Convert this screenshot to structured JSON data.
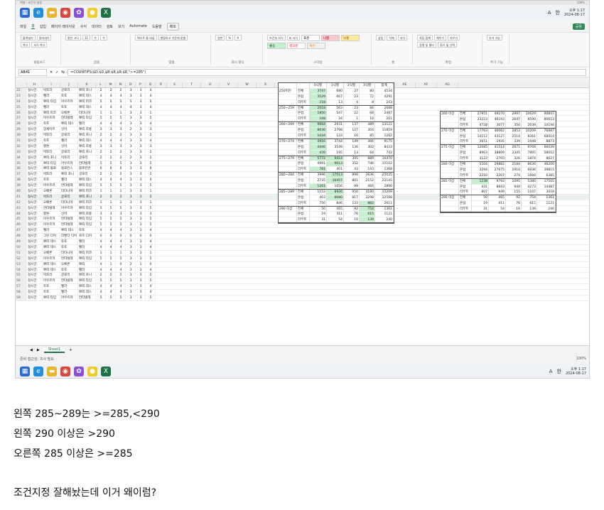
{
  "window": {
    "top_left": "엑셀 - 조건식 설정",
    "top_right": "100%"
  },
  "taskbar": {
    "icons": [
      {
        "name": "windows-icon",
        "glyph": "▦",
        "color": "#2b6cd4"
      },
      {
        "name": "edge-icon",
        "glyph": "e",
        "color": "#1f8ee0"
      },
      {
        "name": "explorer-icon",
        "glyph": "▬",
        "color": "#e8b52c"
      },
      {
        "name": "chrome-icon",
        "glyph": "◉",
        "color": "#d9453b"
      },
      {
        "name": "photos-icon",
        "glyph": "✿",
        "color": "#8a4fd6"
      },
      {
        "name": "kakaotalk-icon",
        "glyph": "●",
        "color": "#f2cc25"
      },
      {
        "name": "excel-icon",
        "glyph": "X",
        "color": "#1e7145"
      }
    ],
    "ime": "A",
    "lang": "한",
    "time": "오후 1:17",
    "date": "2024-08-17"
  },
  "menu": {
    "items": [
      "파일",
      "홈",
      "삽입",
      "페이지 레이아웃",
      "수식",
      "데이터",
      "검토",
      "보기",
      "Automate",
      "도움말"
    ],
    "memo": "메모",
    "share": "공유"
  },
  "ribbon": {
    "groups": [
      {
        "name": "클립보드",
        "buttons": [
          "붙여넣기",
          "잘라내기",
          "복사",
          "서식 복사"
        ]
      },
      {
        "name": "글꼴",
        "buttons": [
          "맑은 고딕",
          "11",
          "가",
          "가"
        ]
      },
      {
        "name": "맞춤",
        "buttons": [
          "텍스트 줄 바꿈",
          "병합하고 가운데 맞춤"
        ]
      },
      {
        "name": "표시 형식",
        "buttons": [
          "일반",
          "%",
          "9"
        ]
      },
      {
        "name": "스타일",
        "buttons": [
          "조건부 서식",
          "표 서식"
        ],
        "styles": [
          {
            "label": "표준",
            "bg": "#ffffff",
            "fg": "#000"
          },
          {
            "label": "나쁨",
            "bg": "#ffc7ce",
            "fg": "#9c0006"
          },
          {
            "label": "보통",
            "bg": "#ffeb9c",
            "fg": "#9c5700"
          },
          {
            "label": "좋음",
            "bg": "#c6efce",
            "fg": "#006100"
          },
          {
            "label": "경고문",
            "bg": "#ffffff",
            "fg": "#ff0000"
          },
          {
            "label": "계산",
            "bg": "#f2f2f2",
            "fg": "#fa7d00"
          }
        ]
      },
      {
        "name": "셀",
        "buttons": [
          "삽입",
          "삭제",
          "서식"
        ]
      },
      {
        "name": "편집",
        "buttons": [
          "자동 합계",
          "채우기",
          "지우기",
          "정렬 및 필터",
          "찾기 및 선택"
        ]
      },
      {
        "name": "추가 기능",
        "buttons": [
          "추가 기능"
        ]
      }
    ]
  },
  "formula": {
    "cell": "AB41",
    "content": "=COUNTIFS($D:$D,$B:$B,$R:$R,\">=285\")"
  },
  "columns": [
    "H",
    "I",
    "J",
    "K",
    "L",
    "M",
    "N",
    "O",
    "P",
    "Q",
    "R",
    "S",
    "T",
    "U",
    "V",
    "W",
    "X",
    "Y",
    "Z",
    "AA",
    "AB",
    "AC",
    "AD",
    "AE",
    "AF",
    "AG"
  ],
  "rows": [
    [
      "22",
      "실시간",
      "빅토리",
      "글로리",
      "뽀띠 포니",
      "2",
      "2",
      "2",
      "3",
      "3",
      "4"
    ],
    [
      "23",
      "실시간",
      "벨라",
      "토토",
      "뽀띠 데스",
      "4",
      "4",
      "4",
      "3",
      "3",
      "4"
    ],
    [
      "24",
      "실시간",
      "뽀띠 타임",
      "마우르카",
      "뽀띠 피코",
      "5",
      "5",
      "5",
      "5",
      "3",
      "5"
    ],
    [
      "25",
      "실시간",
      "벨라",
      "토토",
      "뽀띠 데스",
      "4",
      "4",
      "4",
      "4",
      "3",
      "4"
    ],
    [
      "26",
      "실시간",
      "뽀띠 피코",
      "오베론",
      "티타니아",
      "1",
      "1",
      "1",
      "3",
      "3",
      "1"
    ],
    [
      "27",
      "실시간",
      "마우르카",
      "칸타빌레",
      "뽀띠 타임",
      "5",
      "5",
      "5",
      "3",
      "3",
      "5"
    ],
    [
      "28",
      "실시간",
      "토토",
      "뽀띠 데스",
      "벨라",
      "4",
      "4",
      "4",
      "3",
      "3",
      "4"
    ],
    [
      "29",
      "실시간",
      "장세이르",
      "신마",
      "뽀띠 조롱",
      "3",
      "3",
      "3",
      "2",
      "3",
      "3"
    ],
    [
      "30",
      "실시간",
      "빅토리",
      "글로리",
      "뽀띠 포니",
      "2",
      "2",
      "2",
      "3",
      "3",
      "2"
    ],
    [
      "31",
      "실시간",
      "토토",
      "벨라",
      "뽀띠 데스",
      "4",
      "4",
      "4",
      "3",
      "3",
      "4"
    ],
    [
      "32",
      "실시간",
      "황혼",
      "신마",
      "뽀띠 조롱",
      "3",
      "3",
      "3",
      "3",
      "3",
      "3"
    ],
    [
      "33",
      "실시간",
      "빅토리",
      "글로리",
      "뽀띠 포니",
      "2",
      "2",
      "2",
      "3",
      "3",
      "2"
    ],
    [
      "34",
      "실시간",
      "뽀띠 포니",
      "빅토리",
      "글로리",
      "2",
      "2",
      "2",
      "2",
      "3",
      "2"
    ],
    [
      "35",
      "실시간",
      "뽀띠 타임",
      "마우르카",
      "칸타빌레",
      "5",
      "5",
      "5",
      "3",
      "3",
      "5"
    ],
    [
      "36",
      "실시간",
      "뽀띠 물로",
      "블로킨스",
      "블로킨만",
      "6",
      "6",
      "6",
      "3",
      "3",
      "6"
    ],
    [
      "37",
      "실시간",
      "빅토리",
      "뽀띠 포니",
      "글로리",
      "2",
      "2",
      "2",
      "3",
      "3",
      "2"
    ],
    [
      "38",
      "실시간",
      "토토",
      "벨라",
      "뽀띠 데스",
      "4",
      "4",
      "4",
      "3",
      "3",
      "4"
    ],
    [
      "39",
      "실시간",
      "마우르카",
      "칸타빌레",
      "뽀띠 타임",
      "5",
      "5",
      "5",
      "3",
      "3",
      "5"
    ],
    [
      "40",
      "실시간",
      "오베론",
      "티타니아",
      "뽀띠 피코",
      "1",
      "1",
      "1",
      "3",
      "3",
      "1"
    ],
    [
      "41",
      "실시간",
      "빅토리",
      "글로리",
      "뽀띠 포니",
      "2",
      "2",
      "2",
      "3",
      "3",
      "2"
    ],
    [
      "42",
      "실시간",
      "오베론",
      "티타니아",
      "뽀띠 피코",
      "1",
      "1",
      "1",
      "3",
      "3",
      "1"
    ],
    [
      "43",
      "실시간",
      "칸타빌레",
      "마우르카",
      "뽀띠 타임",
      "5",
      "5",
      "5",
      "3",
      "3",
      "5"
    ],
    [
      "44",
      "실시간",
      "황혼",
      "신마",
      "뽀띠 조롱",
      "3",
      "3",
      "3",
      "3",
      "3",
      "3"
    ],
    [
      "45",
      "실시간",
      "마우르카",
      "칸타빌레",
      "뽀띠 타임",
      "5",
      "5",
      "5",
      "3",
      "3",
      "5"
    ],
    [
      "46",
      "실시간",
      "마우르카",
      "칸타빌레",
      "뽀띠 타임",
      "5",
      "5",
      "5",
      "3",
      "3",
      "5"
    ],
    [
      "47",
      "실시간",
      "벨라",
      "뽀띠 데스",
      "토토",
      "4",
      "4",
      "4",
      "3",
      "3",
      "4"
    ],
    [
      "48",
      "실시간",
      "그린 디어",
      "라벤더 디어",
      "로즈 디어",
      "0",
      "0",
      "0",
      "0",
      "0",
      "0"
    ],
    [
      "49",
      "실시간",
      "뽀띠 데스",
      "토토",
      "벨라",
      "4",
      "4",
      "4",
      "3",
      "3",
      "4"
    ],
    [
      "50",
      "실시간",
      "뽀띠 데스",
      "토토",
      "벨라",
      "4",
      "4",
      "4",
      "3",
      "3",
      "4"
    ],
    [
      "51",
      "실시간",
      "오베론",
      "티타니아",
      "뽀띠 피코",
      "1",
      "1",
      "1",
      "3",
      "3",
      "1"
    ],
    [
      "52",
      "실시간",
      "마우르카",
      "칸타빌레",
      "뽀띠 타임",
      "5",
      "5",
      "5",
      "3",
      "3",
      "5"
    ],
    [
      "53",
      "실시간",
      "뽀띠 데스",
      "오베론",
      "뽀띠",
      "4",
      "1",
      "0",
      "2",
      "1",
      "0"
    ],
    [
      "54",
      "실시간",
      "뽀띠 데스",
      "토토",
      "벨라",
      "4",
      "4",
      "4",
      "3",
      "3",
      "4"
    ],
    [
      "55",
      "실시간",
      "빅토리",
      "글로리",
      "뽀띠 포니",
      "2",
      "2",
      "2",
      "3",
      "3",
      "2"
    ],
    [
      "56",
      "실시간",
      "마우르카",
      "칸타빌레",
      "뽀띠 타임",
      "5",
      "5",
      "5",
      "3",
      "3",
      "5"
    ],
    [
      "57",
      "실시간",
      "토토",
      "벨라",
      "뽀띠 데스",
      "4",
      "4",
      "4",
      "3",
      "3",
      "4"
    ],
    [
      "58",
      "실시간",
      "토토",
      "벨라",
      "뽀띠 데스",
      "4",
      "4",
      "4",
      "3",
      "3",
      "4"
    ],
    [
      "59",
      "실시간",
      "뽀띠 타임",
      "마우르카",
      "칸타빌레",
      "5",
      "5",
      "5",
      "3",
      "3",
      "5"
    ]
  ],
  "left_table": {
    "header": [
      "",
      "",
      "0식별",
      "1식별",
      "2식별",
      "3식별",
      "합계"
    ],
    "groups": [
      {
        "label": "250미만",
        "rows": [
          [
            "전체",
            "3747",
            "680",
            "27",
            "80",
            "4534"
          ],
          [
            "본섭",
            "3529",
            "667",
            "23",
            "72",
            "4291"
          ],
          [
            "리부트",
            "218",
            "13",
            "4",
            "8",
            "243"
          ]
        ]
      },
      {
        "label": "250~259",
        "rows": [
          [
            "전체",
            "2018",
            "563",
            "23",
            "84",
            "2688"
          ],
          [
            "본섭",
            "1850",
            "547",
            "22",
            "68",
            "2487"
          ],
          [
            "리부트",
            "168",
            "16",
            "1",
            "16",
            "201"
          ]
        ]
      },
      {
        "label": "260~269",
        "rows": [
          [
            "전체",
            "9664",
            "2931",
            "137",
            "389",
            "13121"
          ],
          [
            "본섭",
            "8630",
            "2798",
            "127",
            "304",
            "11859"
          ],
          [
            "리부트",
            "1034",
            "133",
            "10",
            "85",
            "1262"
          ]
        ]
      },
      {
        "label": "270~274",
        "rows": [
          [
            "전체",
            "4916",
            "3744",
            "149",
            "366",
            "9175"
          ],
          [
            "본섭",
            "4446",
            "3549",
            "136",
            "302",
            "8433"
          ],
          [
            "리부트",
            "470",
            "195",
            "13",
            "64",
            "742"
          ]
        ]
      },
      {
        "label": "275~279",
        "rows": [
          [
            "전체",
            "5772",
            "9414",
            "395",
            "889",
            "16470"
          ],
          [
            "본섭",
            "4991",
            "9013",
            "352",
            "746",
            "15102"
          ],
          [
            "리부트",
            "781",
            "401",
            "43",
            "143",
            "1368"
          ]
        ]
      },
      {
        "label": "280~284",
        "rows": [
          [
            "전체",
            "3996",
            "17513",
            "890",
            "2636",
            "25035"
          ],
          [
            "본섭",
            "2735",
            "16457",
            "801",
            "2152",
            "22145"
          ],
          [
            "리부트",
            "1261",
            "1056",
            "89",
            "484",
            "2890"
          ]
        ]
      },
      {
        "label": "285~289",
        "rows": [
          [
            "전체",
            "1153",
            "8926",
            "950",
            "4180",
            "15209"
          ],
          [
            "본섭",
            "403",
            "8080",
            "817",
            "3298",
            "12598"
          ],
          [
            "리부트",
            "750",
            "846",
            "133",
            "882",
            "2611"
          ]
        ]
      },
      {
        "label": "290 이상",
        "rows": [
          [
            "전체",
            "50",
            "465",
            "92",
            "754",
            "1361"
          ],
          [
            "본섭",
            "19",
            "411",
            "76",
            "615",
            "1121"
          ],
          [
            "리부트",
            "31",
            "54",
            "16",
            "139",
            "240"
          ]
        ]
      }
    ],
    "highlights": [
      [
        0,
        0,
        1
      ],
      [
        0,
        1,
        1
      ],
      [
        0,
        2,
        1
      ],
      [
        1,
        0,
        1
      ],
      [
        1,
        1,
        1
      ],
      [
        1,
        2,
        1
      ],
      [
        2,
        0,
        1
      ],
      [
        2,
        1,
        1
      ],
      [
        2,
        2,
        1
      ],
      [
        3,
        0,
        1
      ],
      [
        3,
        1,
        1
      ],
      [
        3,
        2,
        1
      ],
      [
        4,
        0,
        1
      ],
      [
        4,
        0,
        2
      ],
      [
        4,
        1,
        2
      ],
      [
        4,
        2,
        1
      ],
      [
        5,
        0,
        2
      ],
      [
        5,
        1,
        2
      ],
      [
        5,
        2,
        1
      ],
      [
        6,
        0,
        2
      ],
      [
        6,
        1,
        2
      ],
      [
        6,
        2,
        4
      ],
      [
        7,
        0,
        4
      ],
      [
        7,
        1,
        4
      ],
      [
        7,
        2,
        4
      ]
    ]
  },
  "right_table": {
    "groups": [
      {
        "label": "260 이상",
        "rows": [
          [
            "전체",
            "27951",
            "49270",
            "2997",
            "10629",
            "90847"
          ],
          [
            "본섭",
            "23223",
            "46193",
            "2647",
            "8590",
            "80653"
          ],
          [
            "리부트",
            "4728",
            "3077",
            "350",
            "2039",
            "10194"
          ]
        ]
      },
      {
        "label": "270 이상",
        "rows": [
          [
            "전체",
            "17763",
            "46062",
            "2853",
            "10209",
            "76887"
          ],
          [
            "본섭",
            "14112",
            "43127",
            "2514",
            "8261",
            "68014"
          ],
          [
            "리부트",
            "3651",
            "2935",
            "339",
            "1948",
            "8873"
          ]
        ]
      },
      {
        "label": "275 이상",
        "rows": [
          [
            "전체",
            "12085",
            "41514",
            "2671",
            "9769",
            "66039"
          ],
          [
            "본섭",
            "8963",
            "38809",
            "2345",
            "7895",
            "58012"
          ],
          [
            "리부트",
            "3122",
            "2705",
            "326",
            "1874",
            "8027"
          ]
        ]
      },
      {
        "label": "280 이상",
        "rows": [
          [
            "전체",
            "5504",
            "29882",
            "2184",
            "8630",
            "46200"
          ],
          [
            "본섭",
            "3294",
            "27675",
            "1910",
            "6936",
            "39815"
          ],
          [
            "리부트",
            "2210",
            "2207",
            "274",
            "1694",
            "6385"
          ]
        ]
      },
      {
        "label": "285 이상",
        "rows": [
          [
            "전체",
            "1238",
            "9792",
            "1095",
            "5380",
            "17505"
          ],
          [
            "본섭",
            "431",
            "8843",
            "940",
            "4273",
            "14487"
          ],
          [
            "리부트",
            "807",
            "949",
            "155",
            "1107",
            "3018"
          ]
        ]
      },
      {
        "label": "290 이상",
        "rows": [
          [
            "전체",
            "50",
            "465",
            "92",
            "754",
            "1361"
          ],
          [
            "본섭",
            "19",
            "411",
            "76",
            "615",
            "1121"
          ],
          [
            "리부트",
            "31",
            "54",
            "16",
            "139",
            "240"
          ]
        ]
      }
    ]
  },
  "sheet": {
    "tab": "Sheet1",
    "status_left": "준비   접근성: 조사 필요",
    "zoom": "100%"
  },
  "caption": {
    "line1": "왼쪽 285~289는 >=285,<290",
    "line2": "왼쪽 290 이상은 >290",
    "line3": "오른쪽 285 이상은 >=285",
    "line4": "조건지정 잘해놨는데 이거 왜이럼?"
  }
}
